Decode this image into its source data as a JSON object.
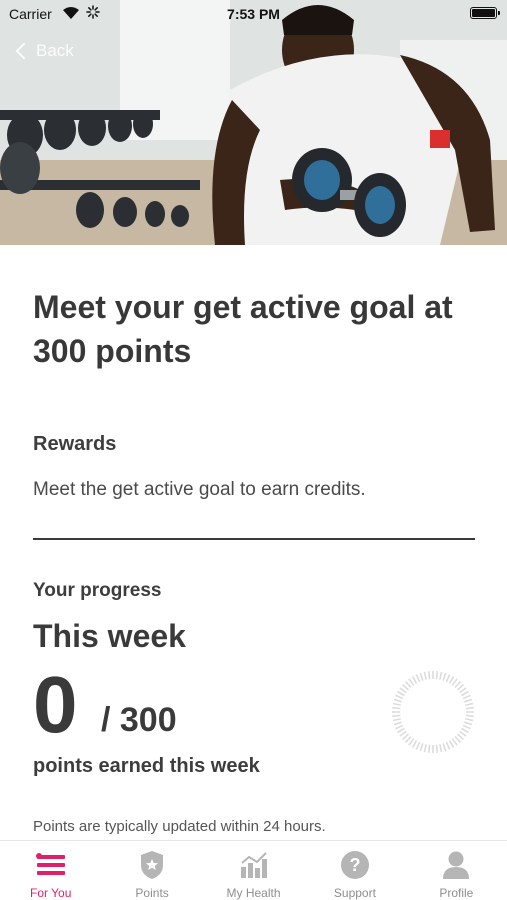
{
  "status_bar": {
    "carrier": "Carrier",
    "time": "7:53 PM"
  },
  "nav": {
    "back_label": "Back"
  },
  "headline": "Meet your get active goal at 300 points",
  "rewards": {
    "title": "Rewards",
    "text": "Meet the get active goal to earn credits."
  },
  "progress": {
    "section_label": "Your progress",
    "period": "This week",
    "points_earned": "0",
    "points_goal_text": "/ 300",
    "caption": "points earned this week",
    "note": "Points are typically updated within 24 hours.",
    "fraction": 0
  },
  "tabs": [
    {
      "label": "For You",
      "icon": "for-you-icon",
      "active": true
    },
    {
      "label": "Points",
      "icon": "points-badge-icon",
      "active": false
    },
    {
      "label": "My Health",
      "icon": "health-chart-icon",
      "active": false
    },
    {
      "label": "Support",
      "icon": "help-icon",
      "active": false
    },
    {
      "label": "Profile",
      "icon": "profile-icon",
      "active": false
    }
  ],
  "colors": {
    "accent": "#e0206a",
    "inactive": "#b5b5b5",
    "text": "#3a3a3a"
  }
}
